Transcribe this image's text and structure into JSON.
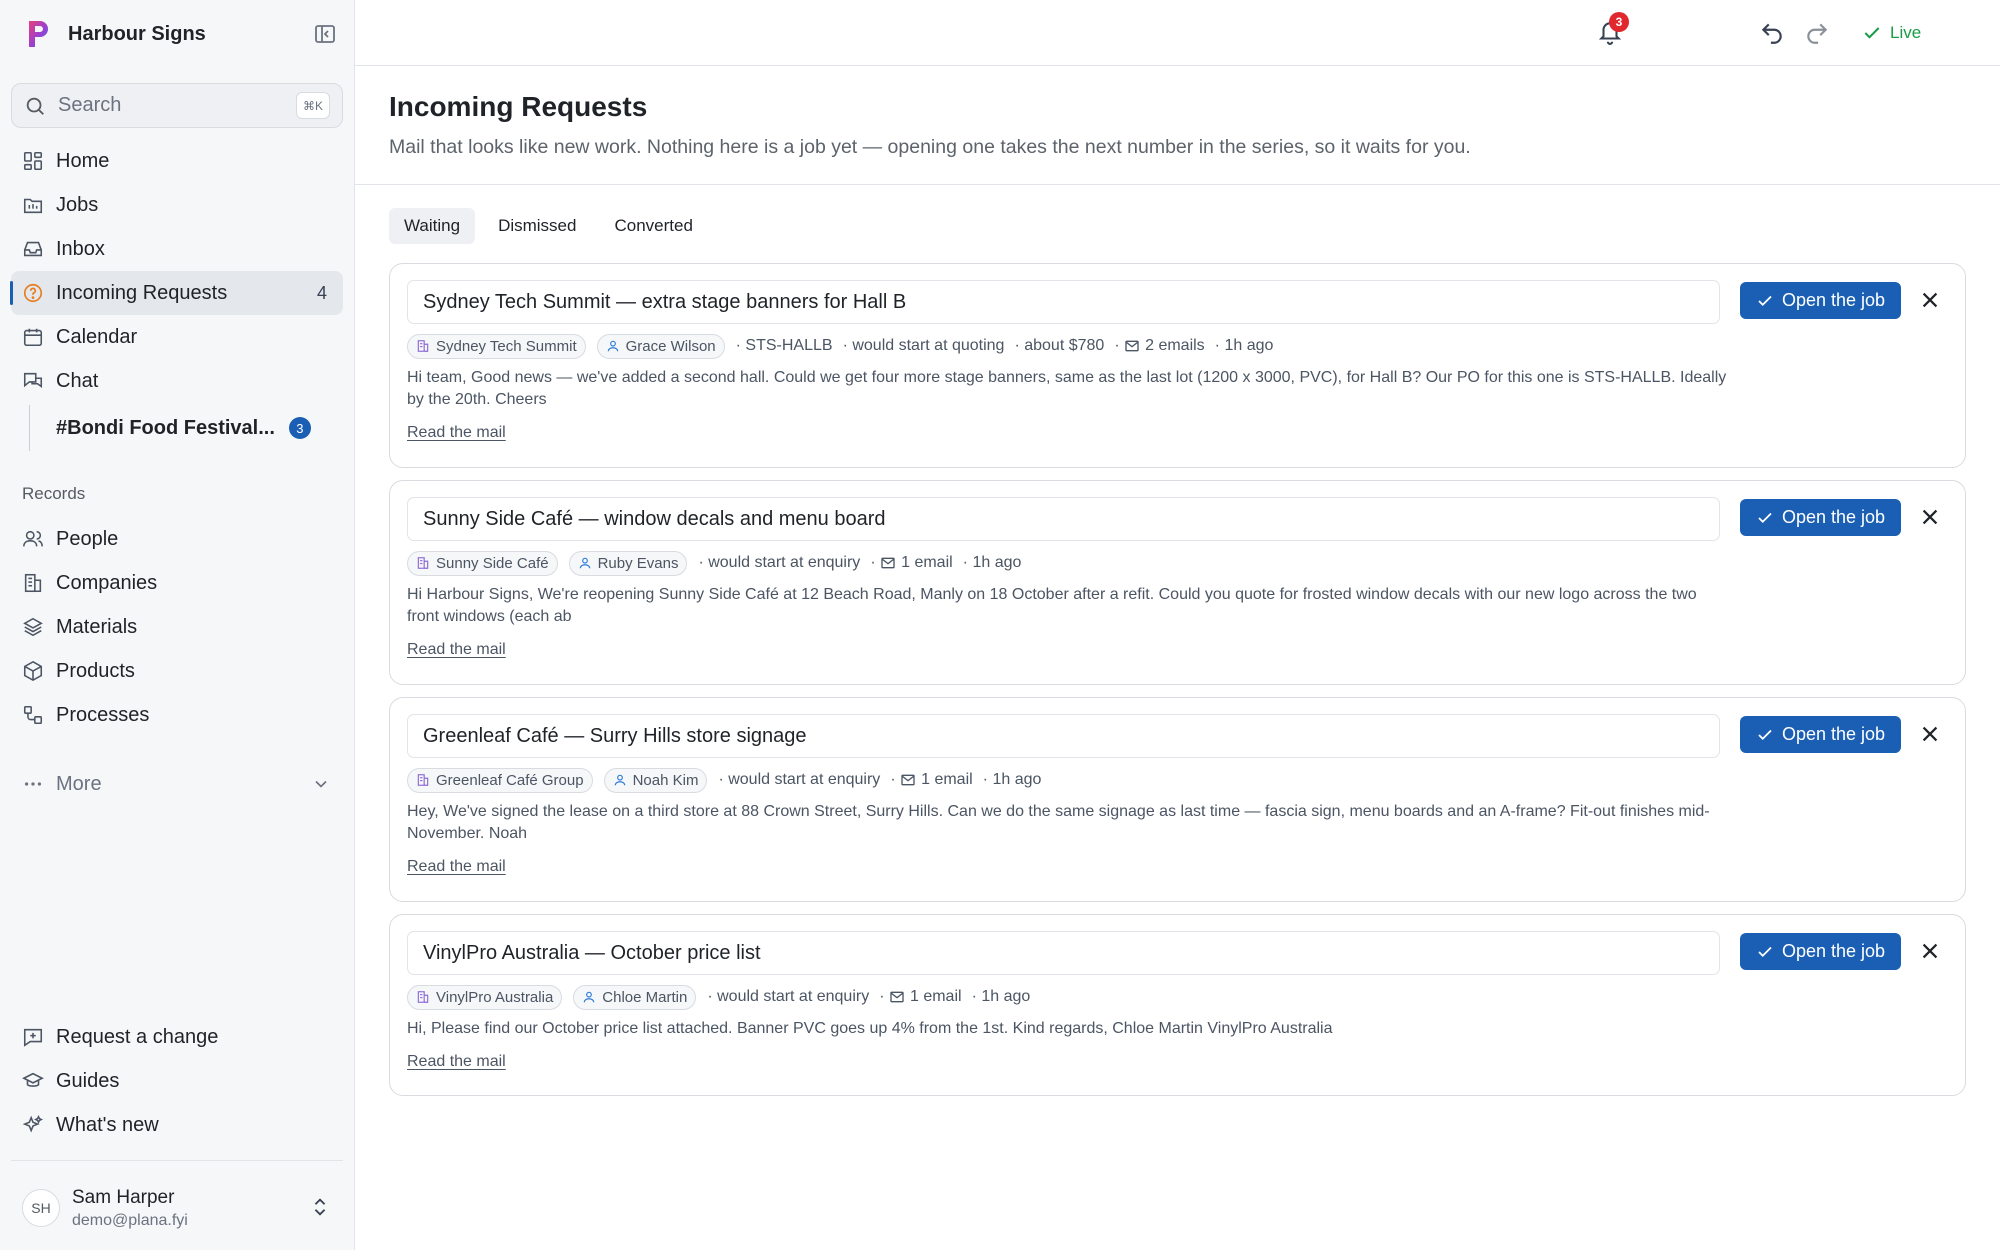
{
  "app": {
    "name": "Harbour Signs"
  },
  "search": {
    "placeholder": "Search",
    "shortcut": "⌘K"
  },
  "nav": [
    {
      "label": "Home",
      "icon": "home-grid-icon"
    },
    {
      "label": "Jobs",
      "icon": "jobs-icon"
    },
    {
      "label": "Inbox",
      "icon": "inbox-icon"
    },
    {
      "label": "Incoming Requests",
      "icon": "help-circle-icon",
      "count": "4",
      "active": true
    },
    {
      "label": "Calendar",
      "icon": "calendar-icon"
    },
    {
      "label": "Chat",
      "icon": "chat-icon"
    }
  ],
  "chat_channel": {
    "name": "#Bondi Food Festival...",
    "unread": "3"
  },
  "records": {
    "label": "Records",
    "items": [
      {
        "label": "People",
        "icon": "people-icon"
      },
      {
        "label": "Companies",
        "icon": "companies-icon"
      },
      {
        "label": "Materials",
        "icon": "layers-icon"
      },
      {
        "label": "Products",
        "icon": "box-icon"
      },
      {
        "label": "Processes",
        "icon": "processes-icon"
      }
    ]
  },
  "more": {
    "label": "More"
  },
  "footer_links": [
    {
      "label": "Request a change",
      "icon": "feedback-icon"
    },
    {
      "label": "Guides",
      "icon": "graduation-cap-icon"
    },
    {
      "label": "What's new",
      "icon": "sparkles-icon"
    }
  ],
  "user": {
    "initials": "SH",
    "name": "Sam Harper",
    "email": "demo@plana.fyi"
  },
  "topbar": {
    "live_label": "Live",
    "notifications": "3"
  },
  "page": {
    "title": "Incoming Requests",
    "subtitle": "Mail that looks like new work. Nothing here is a job yet — opening one takes the next number in the series, so it waits for you."
  },
  "tabs": [
    {
      "label": "Waiting",
      "active": true
    },
    {
      "label": "Dismissed"
    },
    {
      "label": "Converted"
    }
  ],
  "actions": {
    "open_label": "Open the job",
    "read_label": "Read the mail"
  },
  "requests": [
    {
      "title": "Sydney Tech Summit — extra stage banners for Hall B",
      "company": "Sydney Tech Summit",
      "person": "Grace Wilson",
      "meta": [
        "· STS-HALLB",
        "· would start at quoting",
        "· about $780"
      ],
      "emails": "2 emails",
      "age": "· 1h ago",
      "excerpt": "Hi team, Good news — we've added a second hall. Could we get four more stage banners, same as the last lot (1200 x 3000, PVC), for Hall B? Our PO for this one is STS-HALLB. Ideally by the 20th. Cheers"
    },
    {
      "title": "Sunny Side Café — window decals and menu board",
      "company": "Sunny Side Café",
      "person": "Ruby Evans",
      "meta": [
        "· would start at enquiry"
      ],
      "emails": "1 email",
      "age": "· 1h ago",
      "excerpt": "Hi Harbour Signs, We're reopening Sunny Side Café at 12 Beach Road, Manly on 18 October after a refit. Could you quote for frosted window decals with our new logo across the two front windows (each ab"
    },
    {
      "title": "Greenleaf Café — Surry Hills store signage",
      "company": "Greenleaf Café Group",
      "person": "Noah Kim",
      "meta": [
        "· would start at enquiry"
      ],
      "emails": "1 email",
      "age": "· 1h ago",
      "excerpt": "Hey, We've signed the lease on a third store at 88 Crown Street, Surry Hills. Can we do the same signage as last time — fascia sign, menu boards and an A-frame? Fit-out finishes mid-November. Noah"
    },
    {
      "title": "VinylPro Australia — October price list",
      "company": "VinylPro Australia",
      "person": "Chloe Martin",
      "meta": [
        "· would start at enquiry"
      ],
      "emails": "1 email",
      "age": "· 1h ago",
      "excerpt": "Hi, Please find our October price list attached. Banner PVC goes up 4% from the 1st. Kind regards, Chloe Martin VinylPro Australia"
    }
  ]
}
